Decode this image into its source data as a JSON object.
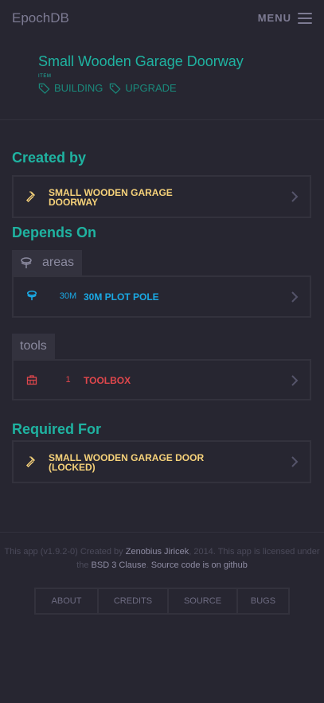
{
  "navbar": {
    "brand": "EpochDB",
    "menu_label": "MENU"
  },
  "item": {
    "title": "Small Wooden Garage Doorway",
    "type": "ITEM",
    "tags": [
      "BUILDING",
      "UPGRADE"
    ]
  },
  "created_by": {
    "title": "Created by",
    "items": [
      {
        "name_line1": "SMALL WOODEN GARAGE",
        "name_line2": "DOORWAY",
        "icon": "hammer-icon"
      }
    ]
  },
  "depends_on": {
    "title": "Depends On",
    "groups": [
      {
        "label": "areas",
        "icon": "plot-pole-icon",
        "items": [
          {
            "qty": "30M",
            "name": "30M PLOT POLE",
            "icon": "plot-pole-icon"
          }
        ]
      },
      {
        "label": "tools",
        "items": [
          {
            "qty": "1",
            "name": "TOOLBOX",
            "icon": "toolbox-icon"
          }
        ]
      }
    ]
  },
  "required_for": {
    "title": "Required For",
    "items": [
      {
        "name_line1": "SMALL WOODEN GARAGE DOOR",
        "name_line2": "(LOCKED)",
        "icon": "hammer-icon"
      }
    ]
  },
  "footer": {
    "text_before_author": "This app (v1.9.2-0) Created by ",
    "author": "Zenobius Jiricek",
    "text_after_author": ", 2014. This app is licensed under",
    "text_before_license": "the ",
    "license": "BSD 3 Clause",
    "text_between": ". ",
    "source_link": "Source code is on github",
    "links": [
      "ABOUT",
      "CREDITS",
      "SOURCE",
      "BUGS"
    ]
  },
  "colors": {
    "background": "#272631",
    "accent": "#1fb3a1",
    "created_by": "#f6d27a",
    "area": "#1aa9e4",
    "tool": "#e0474c"
  }
}
